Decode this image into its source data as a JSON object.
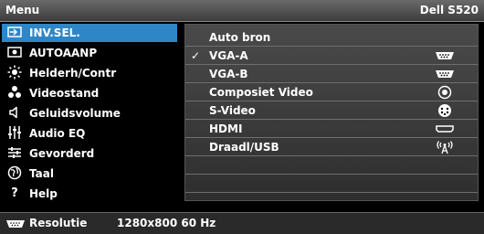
{
  "header": {
    "title": "Menu",
    "model": "Dell S520"
  },
  "sidebar": {
    "items": [
      {
        "label": "INV.SEL.",
        "icon": "input-select-icon",
        "selected": true
      },
      {
        "label": "AUTOAANP",
        "icon": "auto-adjust-icon"
      },
      {
        "label": "Helderh/Contr",
        "icon": "brightness-icon"
      },
      {
        "label": "Videostand",
        "icon": "video-mode-icon"
      },
      {
        "label": "Geluidsvolume",
        "icon": "speaker-icon"
      },
      {
        "label": "Audio EQ",
        "icon": "equalizer-icon"
      },
      {
        "label": "Gevorderd",
        "icon": "advanced-settings-icon"
      },
      {
        "label": "Taal",
        "icon": "globe-icon"
      },
      {
        "label": "Help",
        "icon": "help-icon"
      }
    ]
  },
  "sources": {
    "items": [
      {
        "label": "Auto bron",
        "check": "",
        "icon": ""
      },
      {
        "label": "VGA-A",
        "check": "✓",
        "icon": "vga-connector-icon"
      },
      {
        "label": "VGA-B",
        "check": "",
        "icon": "vga-connector-icon"
      },
      {
        "label": "Composiet Video",
        "check": "",
        "icon": "composite-video-icon"
      },
      {
        "label": "S-Video",
        "check": "",
        "icon": "s-video-icon"
      },
      {
        "label": "HDMI",
        "check": "",
        "icon": "hdmi-connector-icon"
      },
      {
        "label": "Draadl/USB",
        "check": "",
        "icon": "wireless-icon"
      },
      {
        "label": "",
        "check": "",
        "icon": ""
      },
      {
        "label": "",
        "check": "",
        "icon": ""
      },
      {
        "label": "",
        "check": "",
        "icon": ""
      }
    ]
  },
  "footer": {
    "icon": "vga-connector-icon",
    "label": "Resolutie",
    "value": "1280x800 60 Hz"
  },
  "colors": {
    "selected": "#2f86c6",
    "header": "#5a5a5a",
    "panel": "#3c3c3c"
  }
}
